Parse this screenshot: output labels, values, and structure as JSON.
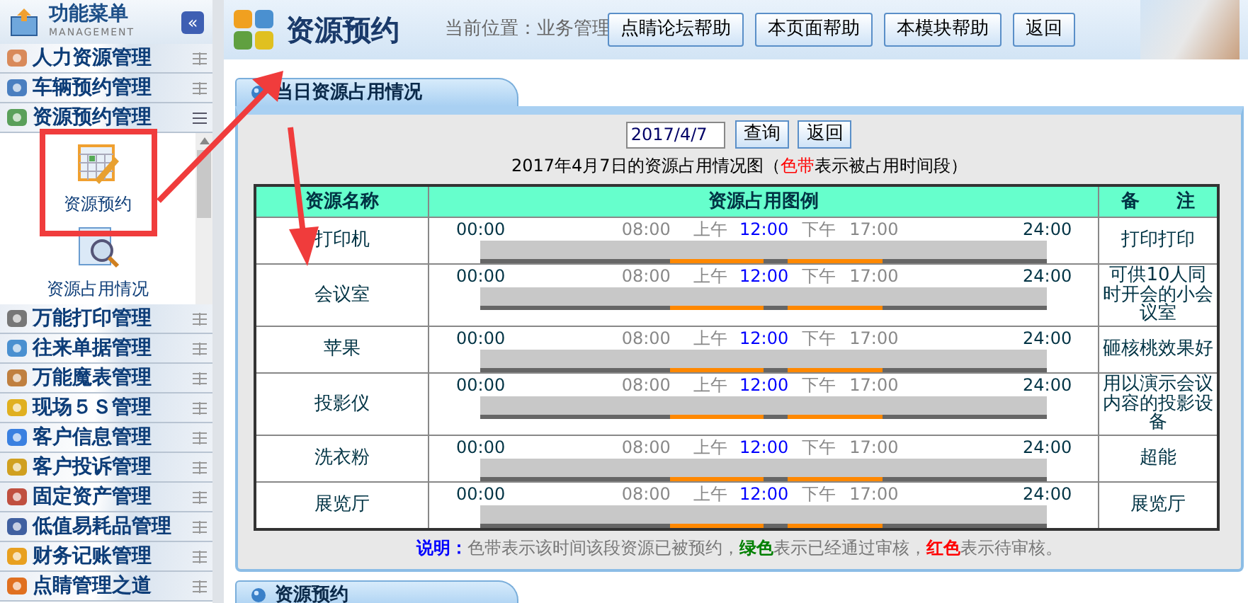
{
  "sidebar": {
    "title": "功能菜单",
    "subtitle": "MANAGEMENT",
    "collapse_label": "«",
    "items": [
      {
        "label": "人力资源管理",
        "expanded": false
      },
      {
        "label": "车辆预约管理",
        "expanded": false
      },
      {
        "label": "资源预约管理",
        "expanded": true,
        "children": [
          {
            "label": "资源预约"
          },
          {
            "label": "资源占用情况"
          }
        ]
      },
      {
        "label": "万能打印管理",
        "expanded": false
      },
      {
        "label": "往来单据管理",
        "expanded": false
      },
      {
        "label": "万能魔表管理",
        "expanded": false
      },
      {
        "label": "现场５Ｓ管理",
        "expanded": false
      },
      {
        "label": "客户信息管理",
        "expanded": false
      },
      {
        "label": "客户投诉管理",
        "expanded": false
      },
      {
        "label": "固定资产管理",
        "expanded": false
      },
      {
        "label": "低值易耗品管理",
        "expanded": false
      },
      {
        "label": "财务记账管理",
        "expanded": false
      },
      {
        "label": "点睛管理之道",
        "expanded": false
      }
    ]
  },
  "header": {
    "title": "资源预约",
    "breadcrumb": "当前位置：业务管理",
    "buttons": [
      "点睛论坛帮助",
      "本页面帮助",
      "本模块帮助",
      "返回"
    ]
  },
  "panel": {
    "tab": "当日资源占用情况",
    "date": "2017/4/7",
    "buttons": [
      "查询",
      "返回"
    ],
    "caption": [
      {
        "text": "2017年4月7日的资源占用情况图（",
        "color": "#000000"
      },
      {
        "text": "色带",
        "color": "#ff0000"
      },
      {
        "text": "表示被占用时间段）",
        "color": "#000000"
      }
    ],
    "table": {
      "columns": [
        "资源名称",
        "资源占用图例",
        "备　　注"
      ],
      "rows": [
        {
          "name": "打印机",
          "note": "打印打印",
          "scale": [
            {
              "text": "00:00",
              "kind": "edge"
            },
            {
              "text": "08:00",
              "kind": "work"
            },
            {
              "text": "上午",
              "kind": "work"
            },
            {
              "text": "12:00",
              "kind": "noon"
            },
            {
              "text": "下午",
              "kind": "work"
            },
            {
              "text": "17:00",
              "kind": "work"
            },
            {
              "text": "24:00",
              "kind": "edge"
            }
          ],
          "slots": [
            {
              "booked": false
            },
            {
              "booked": false
            },
            {
              "booked": false
            },
            {
              "booked": false
            },
            {
              "booked": false
            },
            {
              "booked": false
            },
            {
              "booked": false
            },
            {
              "booked": false
            },
            {
              "booked": true
            },
            {
              "booked": true
            },
            {
              "booked": true
            },
            {
              "booked": true
            },
            {
              "booked": false
            },
            {
              "booked": true
            },
            {
              "booked": true
            },
            {
              "booked": true
            },
            {
              "booked": true
            },
            {
              "booked": false
            },
            {
              "booked": false
            },
            {
              "booked": false
            },
            {
              "booked": false
            },
            {
              "booked": false
            },
            {
              "booked": false
            },
            {
              "booked": false
            }
          ]
        },
        {
          "name": "会议室",
          "note": "可供10人同时开会的小会议室",
          "scale": [
            {
              "text": "00:00",
              "kind": "edge"
            },
            {
              "text": "08:00",
              "kind": "work"
            },
            {
              "text": "上午",
              "kind": "work"
            },
            {
              "text": "12:00",
              "kind": "noon"
            },
            {
              "text": "下午",
              "kind": "work"
            },
            {
              "text": "17:00",
              "kind": "work"
            },
            {
              "text": "24:00",
              "kind": "edge"
            }
          ],
          "slots": [
            {
              "booked": false
            },
            {
              "booked": false
            },
            {
              "booked": false
            },
            {
              "booked": false
            },
            {
              "booked": false
            },
            {
              "booked": false
            },
            {
              "booked": false
            },
            {
              "booked": false
            },
            {
              "booked": true
            },
            {
              "booked": true
            },
            {
              "booked": true
            },
            {
              "booked": true
            },
            {
              "booked": false
            },
            {
              "booked": true
            },
            {
              "booked": true
            },
            {
              "booked": true
            },
            {
              "booked": true
            },
            {
              "booked": false
            },
            {
              "booked": false
            },
            {
              "booked": false
            },
            {
              "booked": false
            },
            {
              "booked": false
            },
            {
              "booked": false
            },
            {
              "booked": false
            }
          ]
        },
        {
          "name": "苹果",
          "note": "砸核桃效果好",
          "scale": [
            {
              "text": "00:00",
              "kind": "edge"
            },
            {
              "text": "08:00",
              "kind": "work"
            },
            {
              "text": "上午",
              "kind": "work"
            },
            {
              "text": "12:00",
              "kind": "noon"
            },
            {
              "text": "下午",
              "kind": "work"
            },
            {
              "text": "17:00",
              "kind": "work"
            },
            {
              "text": "24:00",
              "kind": "edge"
            }
          ],
          "slots": [
            {
              "booked": false
            },
            {
              "booked": false
            },
            {
              "booked": false
            },
            {
              "booked": false
            },
            {
              "booked": false
            },
            {
              "booked": false
            },
            {
              "booked": false
            },
            {
              "booked": false
            },
            {
              "booked": true
            },
            {
              "booked": true
            },
            {
              "booked": true
            },
            {
              "booked": true
            },
            {
              "booked": false
            },
            {
              "booked": true
            },
            {
              "booked": true
            },
            {
              "booked": true
            },
            {
              "booked": true
            },
            {
              "booked": false
            },
            {
              "booked": false
            },
            {
              "booked": false
            },
            {
              "booked": false
            },
            {
              "booked": false
            },
            {
              "booked": false
            },
            {
              "booked": false
            }
          ]
        },
        {
          "name": "投影仪",
          "note": "用以演示会议内容的投影设备",
          "scale": [
            {
              "text": "00:00",
              "kind": "edge"
            },
            {
              "text": "08:00",
              "kind": "work"
            },
            {
              "text": "上午",
              "kind": "work"
            },
            {
              "text": "12:00",
              "kind": "noon"
            },
            {
              "text": "下午",
              "kind": "work"
            },
            {
              "text": "17:00",
              "kind": "work"
            },
            {
              "text": "24:00",
              "kind": "edge"
            }
          ],
          "slots": [
            {
              "booked": false
            },
            {
              "booked": false
            },
            {
              "booked": false
            },
            {
              "booked": false
            },
            {
              "booked": false
            },
            {
              "booked": false
            },
            {
              "booked": false
            },
            {
              "booked": false
            },
            {
              "booked": true
            },
            {
              "booked": true
            },
            {
              "booked": true
            },
            {
              "booked": true
            },
            {
              "booked": false
            },
            {
              "booked": true
            },
            {
              "booked": true
            },
            {
              "booked": true
            },
            {
              "booked": true
            },
            {
              "booked": false
            },
            {
              "booked": false
            },
            {
              "booked": false
            },
            {
              "booked": false
            },
            {
              "booked": false
            },
            {
              "booked": false
            },
            {
              "booked": false
            }
          ]
        },
        {
          "name": "洗衣粉",
          "note": "超能",
          "scale": [
            {
              "text": "00:00",
              "kind": "edge"
            },
            {
              "text": "08:00",
              "kind": "work"
            },
            {
              "text": "上午",
              "kind": "work"
            },
            {
              "text": "12:00",
              "kind": "noon"
            },
            {
              "text": "下午",
              "kind": "work"
            },
            {
              "text": "17:00",
              "kind": "work"
            },
            {
              "text": "24:00",
              "kind": "edge"
            }
          ],
          "slots": [
            {
              "booked": false
            },
            {
              "booked": false
            },
            {
              "booked": false
            },
            {
              "booked": false
            },
            {
              "booked": false
            },
            {
              "booked": false
            },
            {
              "booked": false
            },
            {
              "booked": false
            },
            {
              "booked": true
            },
            {
              "booked": true
            },
            {
              "booked": true
            },
            {
              "booked": true
            },
            {
              "booked": false
            },
            {
              "booked": true
            },
            {
              "booked": true
            },
            {
              "booked": true
            },
            {
              "booked": true
            },
            {
              "booked": false
            },
            {
              "booked": false
            },
            {
              "booked": false
            },
            {
              "booked": false
            },
            {
              "booked": false
            },
            {
              "booked": false
            },
            {
              "booked": false
            }
          ]
        },
        {
          "name": "展览厅",
          "note": "展览厅",
          "scale": [
            {
              "text": "00:00",
              "kind": "edge"
            },
            {
              "text": "08:00",
              "kind": "work"
            },
            {
              "text": "上午",
              "kind": "work"
            },
            {
              "text": "12:00",
              "kind": "noon"
            },
            {
              "text": "下午",
              "kind": "work"
            },
            {
              "text": "17:00",
              "kind": "work"
            },
            {
              "text": "24:00",
              "kind": "edge"
            }
          ],
          "slots": [
            {
              "booked": false
            },
            {
              "booked": false
            },
            {
              "booked": false
            },
            {
              "booked": false
            },
            {
              "booked": false
            },
            {
              "booked": false
            },
            {
              "booked": false
            },
            {
              "booked": false
            },
            {
              "booked": true
            },
            {
              "booked": true
            },
            {
              "booked": true
            },
            {
              "booked": true
            },
            {
              "booked": false
            },
            {
              "booked": true
            },
            {
              "booked": true
            },
            {
              "booked": true
            },
            {
              "booked": true
            },
            {
              "booked": false
            },
            {
              "booked": false
            },
            {
              "booked": false
            },
            {
              "booked": false
            },
            {
              "booked": false
            },
            {
              "booked": false
            },
            {
              "booked": false
            }
          ]
        }
      ]
    },
    "legend_parts": [
      {
        "text": "说明：",
        "kind": "label"
      },
      {
        "text": "色带表示该时间该段资源已被预约，",
        "kind": "plain"
      },
      {
        "text": "绿色",
        "kind": "green"
      },
      {
        "text": "表示已经通过审核，",
        "kind": "plain"
      },
      {
        "text": "红色",
        "kind": "red"
      },
      {
        "text": "表示待审核。",
        "kind": "plain"
      }
    ]
  },
  "panel2": {
    "tab": "资源预约"
  }
}
